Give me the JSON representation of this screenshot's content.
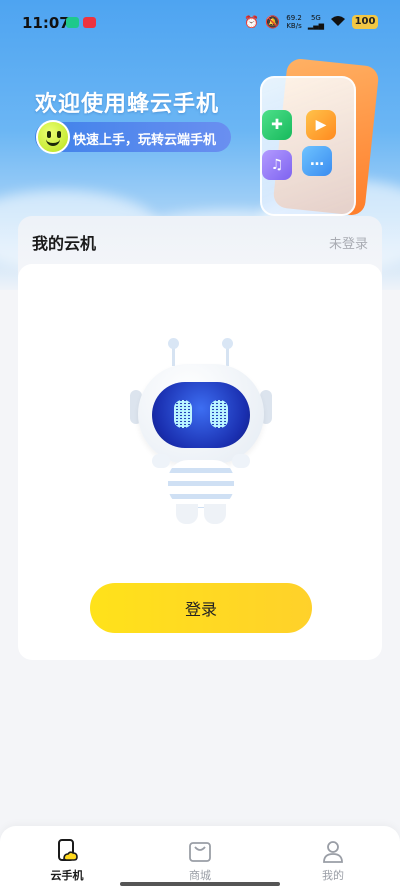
{
  "status_bar": {
    "time": "11:07",
    "network_speed": "69.2",
    "network_unit": "KB/s",
    "signal_label": "5G",
    "battery": "100"
  },
  "hero": {
    "title": "欢迎使用蜂云手机",
    "subtitle": "快速上手，玩转云端手机"
  },
  "card": {
    "title": "我的云机",
    "status": "未登录",
    "login_button": "登录"
  },
  "bottom_nav": {
    "items": [
      {
        "label": "云手机",
        "icon": "cloud-phone-icon",
        "active": true
      },
      {
        "label": "商城",
        "icon": "shopping-bag-icon",
        "active": false
      },
      {
        "label": "我的",
        "icon": "user-icon",
        "active": false
      }
    ]
  },
  "colors": {
    "accent_yellow": "#ffd91f",
    "hero_blue": "#4ea4f1",
    "pill_blue": "#3f82ea"
  }
}
